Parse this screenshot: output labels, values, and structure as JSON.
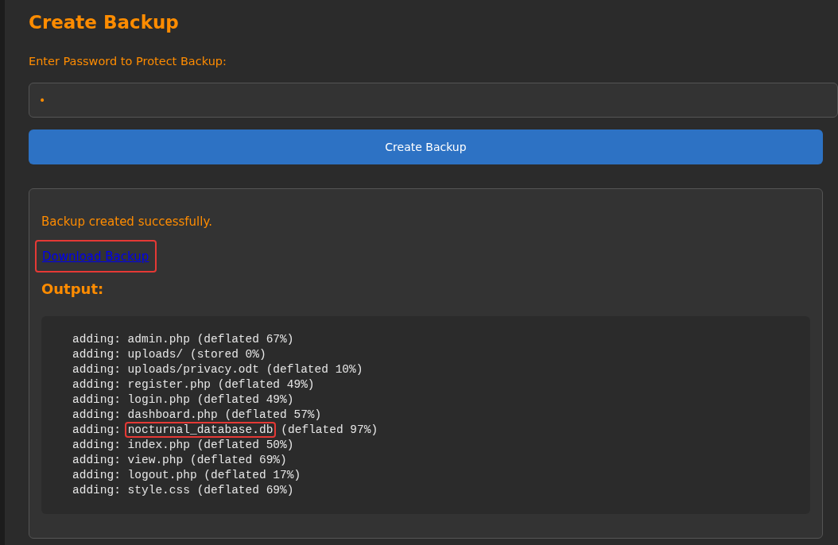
{
  "title": "Create Backup",
  "password": {
    "label": "Enter Password to Protect Backup:",
    "value": "•"
  },
  "submit_button": "Create Backup",
  "result": {
    "message": "Backup created successfully.",
    "download_link": {
      "label": "Download Backup",
      "highlighted": true
    },
    "output_heading": "Output:",
    "output_lines": [
      {
        "action": "adding:",
        "file": "admin.php",
        "info": "(deflated 67%)",
        "highlighted": false
      },
      {
        "action": "adding:",
        "file": "uploads/",
        "info": "(stored 0%)",
        "highlighted": false
      },
      {
        "action": "adding:",
        "file": "uploads/privacy.odt",
        "info": "(deflated 10%)",
        "highlighted": false
      },
      {
        "action": "adding:",
        "file": "register.php",
        "info": "(deflated 49%)",
        "highlighted": false
      },
      {
        "action": "adding:",
        "file": "login.php",
        "info": "(deflated 49%)",
        "highlighted": false
      },
      {
        "action": "adding:",
        "file": "dashboard.php",
        "info": "(deflated 57%)",
        "highlighted": false
      },
      {
        "action": "adding:",
        "file": "nocturnal_database.db",
        "info": "(deflated 97%)",
        "highlighted": true
      },
      {
        "action": "adding:",
        "file": "index.php",
        "info": "(deflated 50%)",
        "highlighted": false
      },
      {
        "action": "adding:",
        "file": "view.php",
        "info": "(deflated 69%)",
        "highlighted": false
      },
      {
        "action": "adding:",
        "file": "logout.php",
        "info": "(deflated 17%)",
        "highlighted": false
      },
      {
        "action": "adding:",
        "file": "style.css",
        "info": "(deflated 69%)",
        "highlighted": false
      }
    ]
  }
}
